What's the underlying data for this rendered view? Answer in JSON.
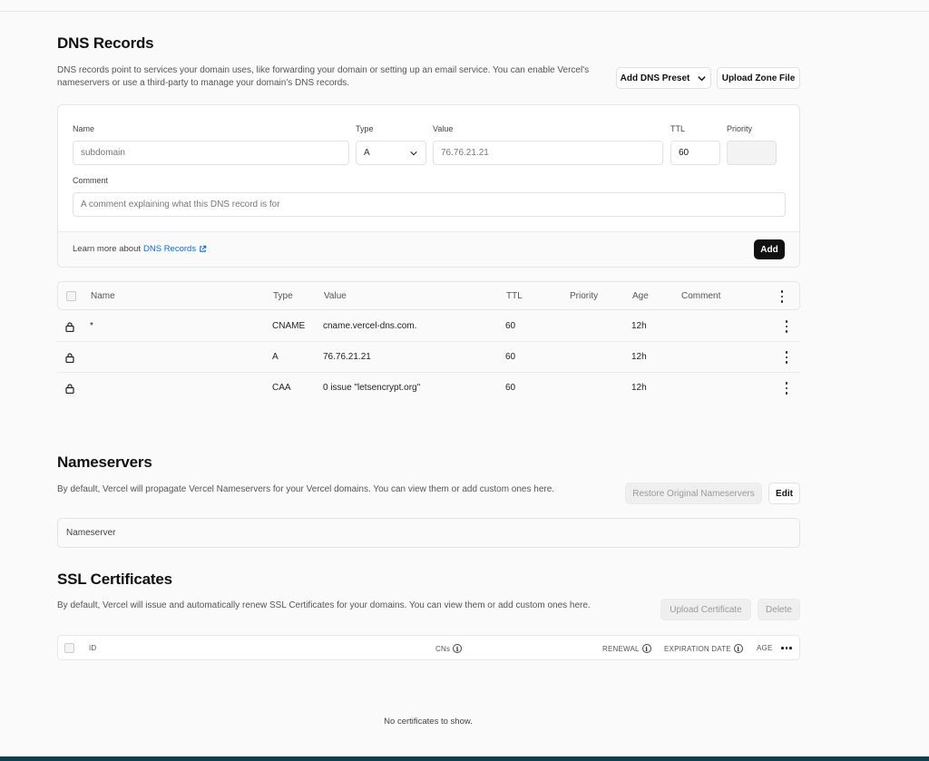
{
  "dns": {
    "title": "DNS Records",
    "description_line1": "DNS records point to services your domain uses, like forwarding your domain or setting up an email service. You can enable Vercel's",
    "description_line2": "nameservers or use a third-party to manage your domain's DNS records.",
    "add_preset_label": "Add DNS Preset",
    "upload_zone_label": "Upload Zone File",
    "form": {
      "name_label": "Name",
      "name_placeholder": "subdomain",
      "type_label": "Type",
      "type_value": "A",
      "value_label": "Value",
      "value_placeholder": "76.76.21.21",
      "ttl_label": "TTL",
      "ttl_value": "60",
      "priority_label": "Priority",
      "comment_label": "Comment",
      "comment_placeholder": "A comment explaining what this DNS record is for",
      "learn_prefix": "Learn more about",
      "learn_link": "DNS Records",
      "add_label": "Add"
    },
    "table": {
      "headers": {
        "name": "Name",
        "type": "Type",
        "value": "Value",
        "ttl": "TTL",
        "priority": "Priority",
        "age": "Age",
        "comment": "Comment"
      },
      "rows": [
        {
          "name": "*",
          "type": "CNAME",
          "value": "cname.vercel-dns.com.",
          "ttl": "60",
          "priority": "",
          "age": "12h",
          "comment": ""
        },
        {
          "name": "",
          "type": "A",
          "value": "76.76.21.21",
          "ttl": "60",
          "priority": "",
          "age": "12h",
          "comment": ""
        },
        {
          "name": "",
          "type": "CAA",
          "value": "0 issue \"letsencrypt.org\"",
          "ttl": "60",
          "priority": "",
          "age": "12h",
          "comment": ""
        }
      ]
    }
  },
  "nameservers": {
    "title": "Nameservers",
    "description": "By default, Vercel will propagate Vercel Nameservers for your Vercel domains. You can view them or add custom ones here.",
    "restore_label": "Restore Original Nameservers",
    "edit_label": "Edit",
    "list_header": "Nameserver"
  },
  "ssl": {
    "title": "SSL Certificates",
    "description": "By default, Vercel will issue and automatically renew SSL Certificates for your domains. You can view them or add custom ones here.",
    "upload_label": "Upload Certificate",
    "delete_label": "Delete",
    "headers": {
      "id": "ID",
      "cns": "CNs",
      "renewal": "RENEWAL",
      "expiration": "EXPIRATION DATE",
      "age": "AGE"
    },
    "info_glyph": "i",
    "empty_text": "No certificates to show."
  },
  "icons": {
    "lock": "lock-icon",
    "chevron": "chevron-down-icon",
    "external": "external-link-icon",
    "kebab": "more-vertical-icon",
    "info": "info-icon",
    "more_h": "more-horizontal-icon"
  },
  "colors": {
    "link": "#0a6cd6",
    "primary_button": "#111111",
    "bottom_bar": "#0f3d4c"
  }
}
